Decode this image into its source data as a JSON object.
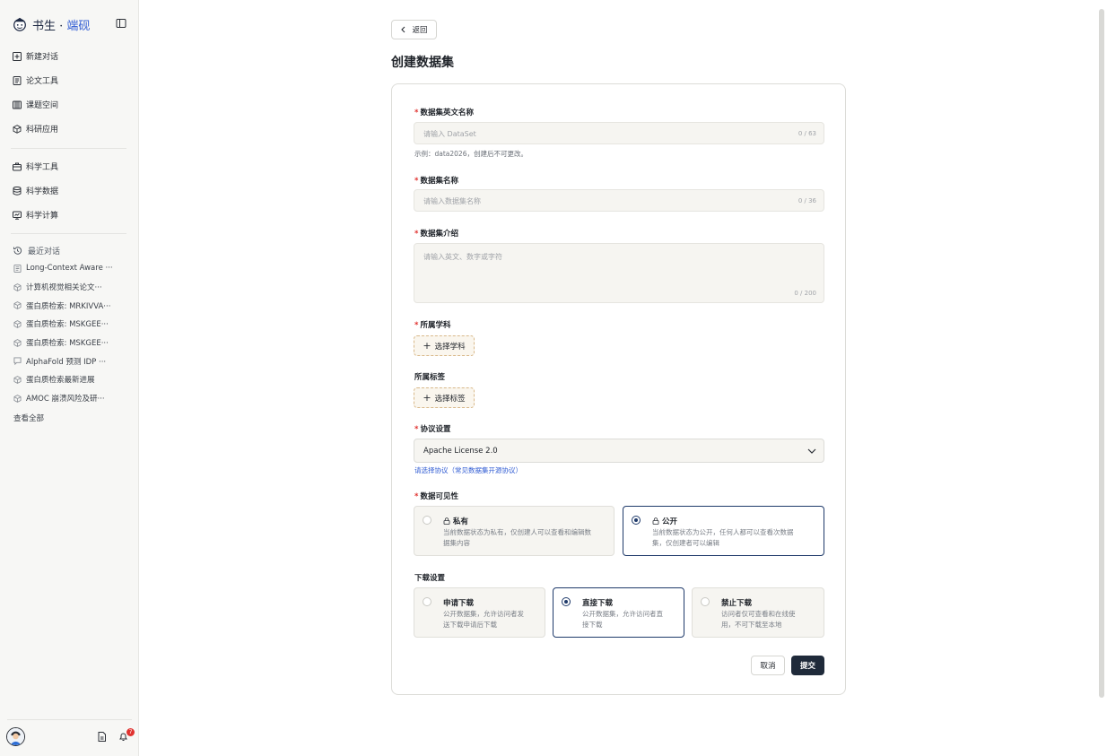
{
  "brand": {
    "name_left": "书生 · ",
    "name_right": "端砚"
  },
  "nav_primary": [
    {
      "label": "新建对话",
      "icon": "plus-square-icon"
    },
    {
      "label": "论文工具",
      "icon": "document-icon"
    },
    {
      "label": "课题空间",
      "icon": "book-icon"
    },
    {
      "label": "科研应用",
      "icon": "cube-icon"
    }
  ],
  "nav_secondary": [
    {
      "label": "科学工具",
      "icon": "toolbox-icon"
    },
    {
      "label": "科学数据",
      "icon": "database-icon"
    },
    {
      "label": "科学计算",
      "icon": "monitor-icon"
    }
  ],
  "recent": {
    "title": "最近对话",
    "items": [
      {
        "label": "Long-Context Aware ···",
        "icon": "document-icon"
      },
      {
        "label": "计算机视觉相关论文···",
        "icon": "cube-icon"
      },
      {
        "label": "蛋白质检索: MRKIVVA···",
        "icon": "cube-icon"
      },
      {
        "label": "蛋白质检索: MSKGEE···",
        "icon": "cube-icon"
      },
      {
        "label": "蛋白质检索: MSKGEE···",
        "icon": "cube-icon"
      },
      {
        "label": "AlphaFold 预测 IDP ···",
        "icon": "chat-icon"
      },
      {
        "label": "蛋白质检索最新进展",
        "icon": "cube-icon"
      },
      {
        "label": "AMOC 崩溃风险及研···",
        "icon": "cube-icon"
      }
    ],
    "view_all": "查看全部"
  },
  "notifications": {
    "count": "7"
  },
  "main": {
    "back_label": "返回",
    "title": "创建数据集",
    "form": {
      "en_name": {
        "label": "数据集英文名称",
        "placeholder": "请输入 DataSet",
        "count": "0 / 63",
        "hint": "示例：data2026，创建后不可更改。"
      },
      "name": {
        "label": "数据集名称",
        "placeholder": "请输入数据集名称",
        "count": "0 / 36"
      },
      "intro": {
        "label": "数据集介绍",
        "placeholder": "请输入英文、数字或字符",
        "count": "0 / 200"
      },
      "subject": {
        "label": "所属学科",
        "button": "选择学科"
      },
      "tags": {
        "label": "所属标签",
        "button": "选择标签"
      },
      "license": {
        "label": "协议设置",
        "value": "Apache License 2.0",
        "hint": "请选择协议（常见数据集开源协议）"
      },
      "visibility": {
        "label": "数据可见性",
        "options": [
          {
            "title": "私有",
            "desc_1": "当前数据状态为私有，仅创建人可以查看和编辑数",
            "desc_2": "据集内容",
            "selected": false
          },
          {
            "title": "公开",
            "desc_1": "当前数据状态为公开，任何人都可以查看次数据",
            "desc_2": "集，仅创建者可以编辑",
            "selected": true
          }
        ]
      },
      "download": {
        "label": "下载设置",
        "options": [
          {
            "title": "申请下载",
            "desc_1": "公开数据集，允许访问者发",
            "desc_2": "送下载申请后下载",
            "selected": false
          },
          {
            "title": "直接下载",
            "desc_1": "公开数据集，允许访问者直",
            "desc_2": "接下载",
            "selected": true
          },
          {
            "title": "禁止下载",
            "desc_1": "访问者仅可查看和在线使",
            "desc_2": "用，不可下载至本地",
            "selected": false
          }
        ]
      },
      "cancel_label": "取消",
      "submit_label": "提交"
    }
  },
  "colors": {
    "primary": "#1f3a6a",
    "submit_bg": "#1f2a3a",
    "required": "#e0322f",
    "link": "#2f5bd3",
    "dashed_border": "#d9b98a"
  }
}
